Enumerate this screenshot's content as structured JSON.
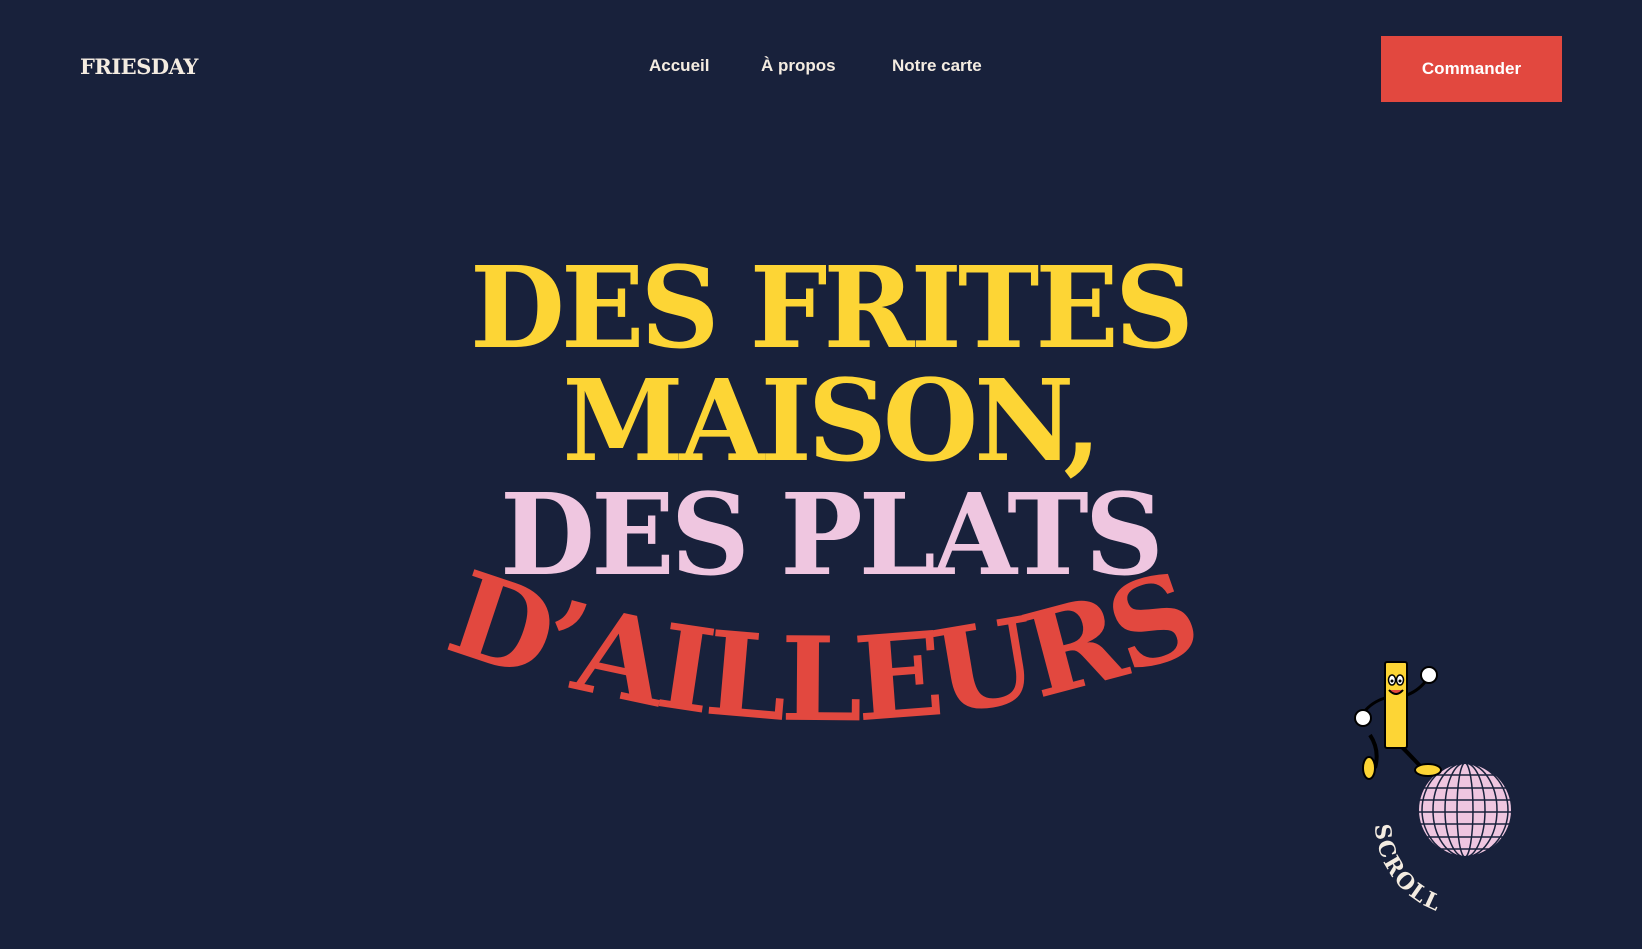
{
  "brand": {
    "logo": "FRIESDAY"
  },
  "nav": {
    "items": [
      {
        "label": "Accueil"
      },
      {
        "label": "À propos"
      },
      {
        "label": "Notre carte"
      }
    ]
  },
  "header": {
    "order_label": "Commander"
  },
  "hero": {
    "line1": "DES FRITES",
    "line2": "MAISON,",
    "line3": "DES PLATS",
    "line4": "D’AILLEURS"
  },
  "scroll": {
    "label": "SCROLL"
  },
  "colors": {
    "background": "#18213b",
    "yellow": "#fdd535",
    "pink": "#efc6e0",
    "red": "#e2483f",
    "cream": "#f4ece1"
  },
  "icons": {
    "mascot": "fry-mascot-icon",
    "disco_ball": "disco-ball-icon"
  }
}
